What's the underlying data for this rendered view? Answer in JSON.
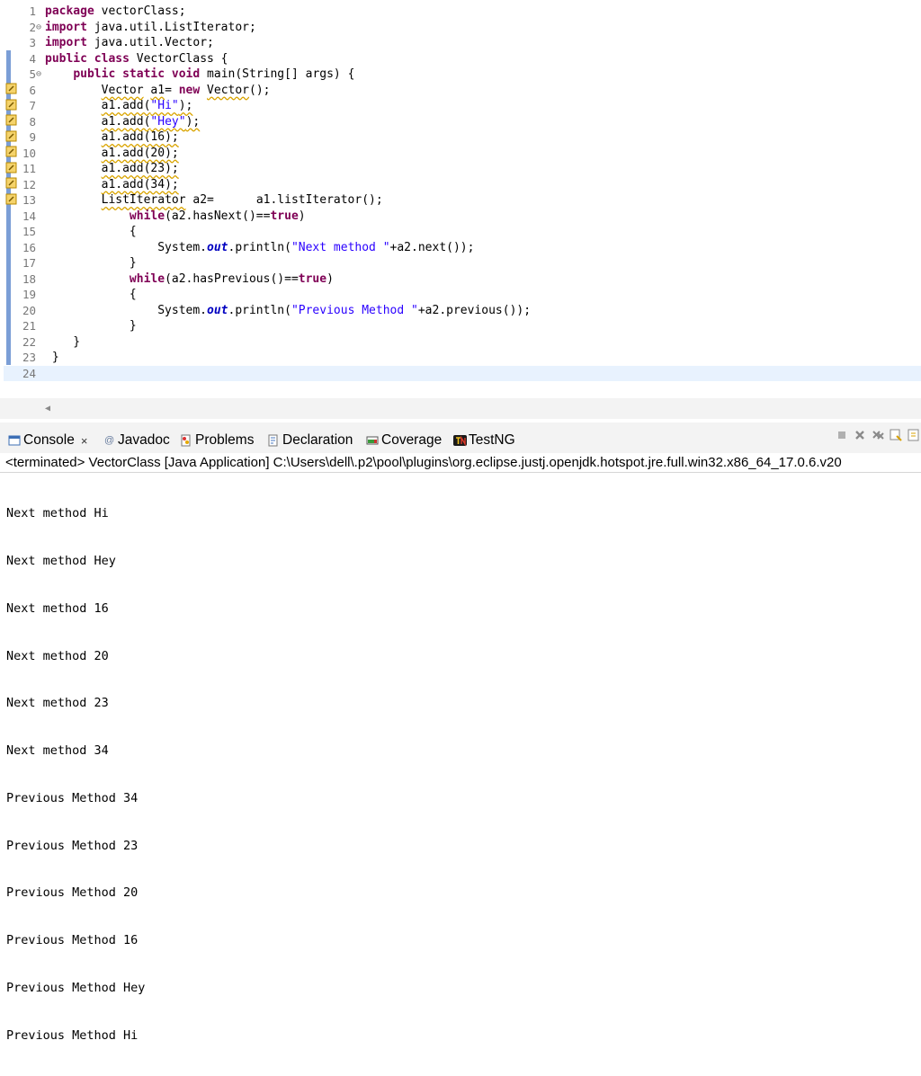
{
  "editor": {
    "line_numbers": [
      "1",
      "2",
      "3",
      "4",
      "5",
      "6",
      "7",
      "8",
      "9",
      "10",
      "11",
      "12",
      "13",
      "14",
      "15",
      "16",
      "17",
      "18",
      "19",
      "20",
      "21",
      "22",
      "23",
      "24"
    ],
    "fold_markers": {
      "2": "⊖",
      "5": "⊖"
    },
    "code": {
      "l1": [
        "package",
        " vectorClass;"
      ],
      "l2": [
        "import",
        " java.util.ListIterator;"
      ],
      "l3": [
        "import",
        " java.util.Vector;"
      ],
      "l4": [
        "public",
        " ",
        "class",
        " VectorClass {"
      ],
      "l5": [
        "    ",
        "public",
        " ",
        "static",
        " ",
        "void",
        " main(String[] args) {"
      ],
      "l6": [
        "        ",
        "Vector",
        " ",
        "a1",
        "= ",
        "new",
        " ",
        "Vector",
        "();"
      ],
      "l7": [
        "        ",
        "a1.add(",
        "\"Hi\"",
        ");"
      ],
      "l8": [
        "        ",
        "a1.add(",
        "\"Hey\"",
        ");"
      ],
      "l9": [
        "        ",
        "a1.add(16);"
      ],
      "l10": [
        "        ",
        "a1.add(20);"
      ],
      "l11": [
        "        ",
        "a1.add(23);"
      ],
      "l12": [
        "        ",
        "a1.add(34);"
      ],
      "l13": [
        "        ",
        "ListIterator",
        " a2=      a1.listIterator();"
      ],
      "l14": [
        "            ",
        "while",
        "(a2.hasNext()==",
        "true",
        ")"
      ],
      "l15": [
        "            {"
      ],
      "l16": [
        "                System.",
        "out",
        ".println(",
        "\"Next method \"",
        "+a2.next());"
      ],
      "l17": [
        "            }"
      ],
      "l18": [
        "            ",
        "while",
        "(a2.hasPrevious()==",
        "true",
        ")"
      ],
      "l19": [
        "            {"
      ],
      "l20": [
        "                System.",
        "out",
        ".println(",
        "\"Previous Method \"",
        "+a2.previous());"
      ],
      "l21": [
        "            }"
      ],
      "l22": [
        "    }"
      ],
      "l23": [
        " }"
      ],
      "l24": [
        ""
      ]
    }
  },
  "console": {
    "tabs": [
      {
        "label": "Console",
        "icon": "console-icon",
        "closable": true
      },
      {
        "label": "Javadoc",
        "icon": "javadoc-icon"
      },
      {
        "label": "Problems",
        "icon": "problems-icon"
      },
      {
        "label": "Declaration",
        "icon": "declaration-icon"
      },
      {
        "label": "Coverage",
        "icon": "coverage-icon"
      },
      {
        "label": "TestNG",
        "icon": "testng-icon"
      }
    ],
    "close_glyph": "×",
    "status": "<terminated> VectorClass [Java Application] C:\\Users\\dell\\.p2\\pool\\plugins\\org.eclipse.justj.openjdk.hotspot.jre.full.win32.x86_64_17.0.6.v20",
    "output": [
      "Next method Hi",
      "Next method Hey",
      "Next method 16",
      "Next method 20",
      "Next method 23",
      "Next method 34",
      "Previous Method 34",
      "Previous Method 23",
      "Previous Method 20",
      "Previous Method 16",
      "Previous Method Hey",
      "Previous Method Hi"
    ]
  },
  "colors": {
    "keyword": "#7f0055",
    "string": "#2a00ff",
    "field": "#0000c0",
    "linenum": "#787878"
  }
}
